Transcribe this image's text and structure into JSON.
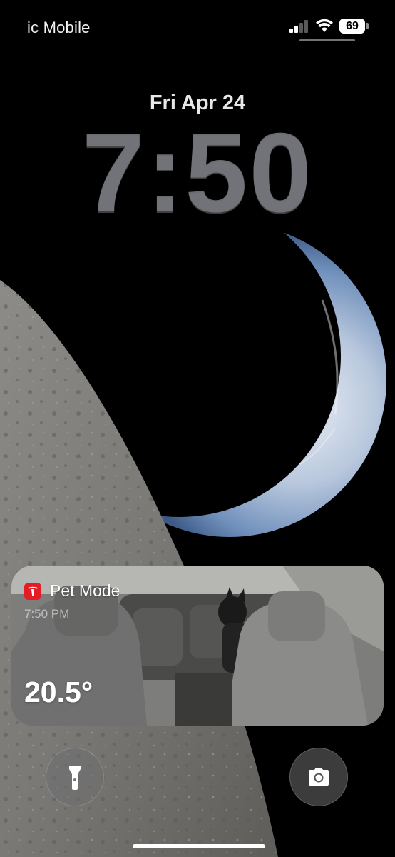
{
  "status_bar": {
    "carrier": "ic Mobile",
    "battery_level": "69",
    "signal_strength": 0.5
  },
  "lock_screen": {
    "date": "Fri Apr 24",
    "time": "7:50"
  },
  "widget": {
    "app_name": "Pet Mode",
    "timestamp": "7:50 PM",
    "temperature": "20.5°",
    "app_icon": "tesla-logo-icon"
  },
  "controls": {
    "left_icon": "flashlight-icon",
    "right_icon": "camera-icon"
  },
  "colors": {
    "accent_red": "#e31c25",
    "clock_gray": "#7a7c80"
  }
}
